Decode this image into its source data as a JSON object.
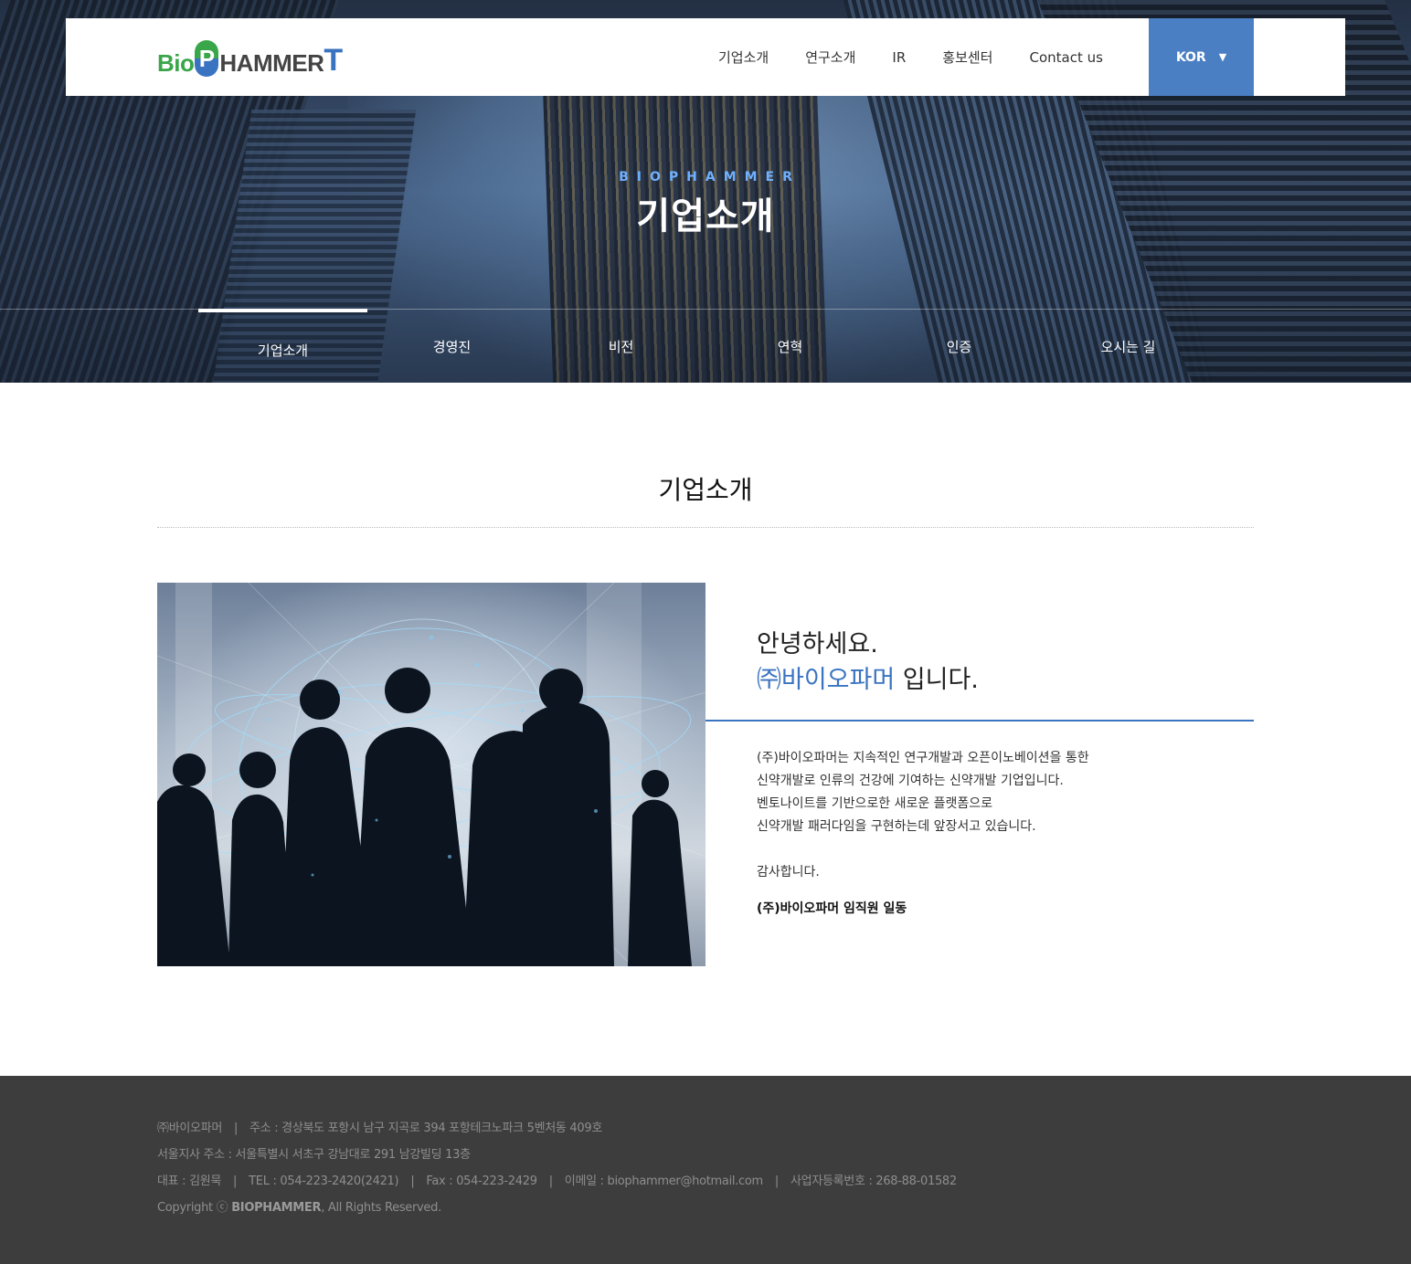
{
  "header": {
    "logo": {
      "bio": "Bio",
      "p": "P",
      "hammer": "HAMME",
      "r": "R",
      "t": "T"
    },
    "nav": [
      "기업소개",
      "연구소개",
      "IR",
      "홍보센터",
      "Contact us"
    ],
    "lang": {
      "label": "KOR",
      "arrow": "▼"
    }
  },
  "hero": {
    "sub": "BIOPHAMMER",
    "title": "기업소개",
    "tabs": [
      "기업소개",
      "경영진",
      "비전",
      "연혁",
      "인증",
      "오시는 길"
    ],
    "active_tab": "기업소개"
  },
  "main": {
    "section_title": "기업소개",
    "greeting_line1": "안녕하세요.",
    "greeting_company": "㈜바이오파머",
    "greeting_suffix": " 입니다.",
    "body_lines": [
      "(주)바이오파머는 지속적인 연구개발과 오픈이노베이션을 통한",
      "신약개발로 인류의 건강에 기여하는 신약개발 기업입니다.",
      "벤토나이트를 기반으로한 새로운 플랫폼으로",
      "신약개발 패러다임을 구현하는데 앞장서고 있습니다."
    ],
    "thanks": "감사합니다.",
    "signature": "(주)바이오파머 임직원 일동"
  },
  "footer": {
    "company": "㈜바이오파머",
    "address": "주소 : 경상북도 포항시 남구 지곡로 394 포항테크노파크 5벤처동 409호",
    "seoul_branch": "서울지사 주소 : 서울특별시 서초구 강남대로 291 남강빌딩 13층",
    "ceo": "대표 : 김원묵",
    "tel": "TEL : 054-223-2420(2421)",
    "fax": "Fax : 054-223-2429",
    "email": "이메일 : biophammer@hotmail.com",
    "biz_no": "사업자등록번호 : 268-88-01582",
    "separator": "|",
    "copyright_prefix": "Copyright ⓒ ",
    "copyright_brand": "BIOPHAMMER",
    "copyright_suffix": ", All Rights Reserved."
  },
  "colors": {
    "accent": "#4b7fc4",
    "brand_blue": "#3a73c0",
    "brand_green": "#3aa64a",
    "footer_bg": "#3d3d3d"
  }
}
